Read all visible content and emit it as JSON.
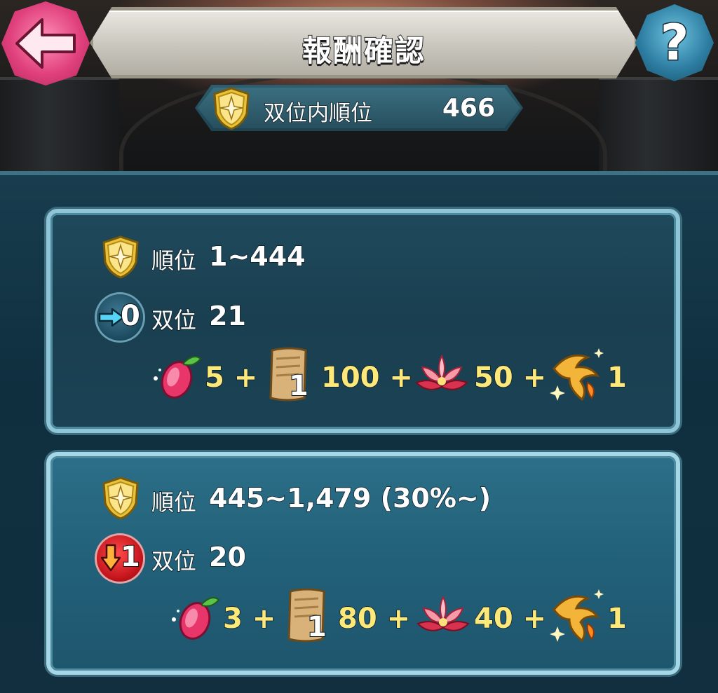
{
  "header": {
    "title": "報酬確認",
    "help_label": "?"
  },
  "rank_summary": {
    "label": "双位内順位",
    "value": "466"
  },
  "reward_tiers": [
    {
      "rank_label": "順位",
      "rank_range": "1~444",
      "tier_change_value": "0",
      "tier_label": "双位",
      "tier_value": "21",
      "rewards": [
        {
          "icon": "crystal-fruit-icon",
          "amount": "5 +"
        },
        {
          "icon": "scroll-icon",
          "badge": "1",
          "amount": "100 +"
        },
        {
          "icon": "lotus-flower-icon",
          "amount": "50 +"
        },
        {
          "icon": "golden-phoenix-icon",
          "amount": "1"
        }
      ]
    },
    {
      "rank_label": "順位",
      "rank_range": "445~1,479 (30%~)",
      "tier_change_value": "1",
      "tier_label": "双位",
      "tier_value": "20",
      "rewards": [
        {
          "icon": "crystal-fruit-icon",
          "amount": "3 +"
        },
        {
          "icon": "scroll-icon",
          "badge": "1",
          "amount": "80 +"
        },
        {
          "icon": "lotus-flower-icon",
          "amount": "40 +"
        },
        {
          "icon": "golden-phoenix-icon",
          "amount": "1"
        }
      ]
    }
  ],
  "colors": {
    "accent_pink": "#e0417d",
    "panel_blue": "#1f4a5c",
    "reward_yellow": "#fde87a",
    "tier_blue": "#1c4a5f",
    "tier_red": "#c4141c"
  }
}
